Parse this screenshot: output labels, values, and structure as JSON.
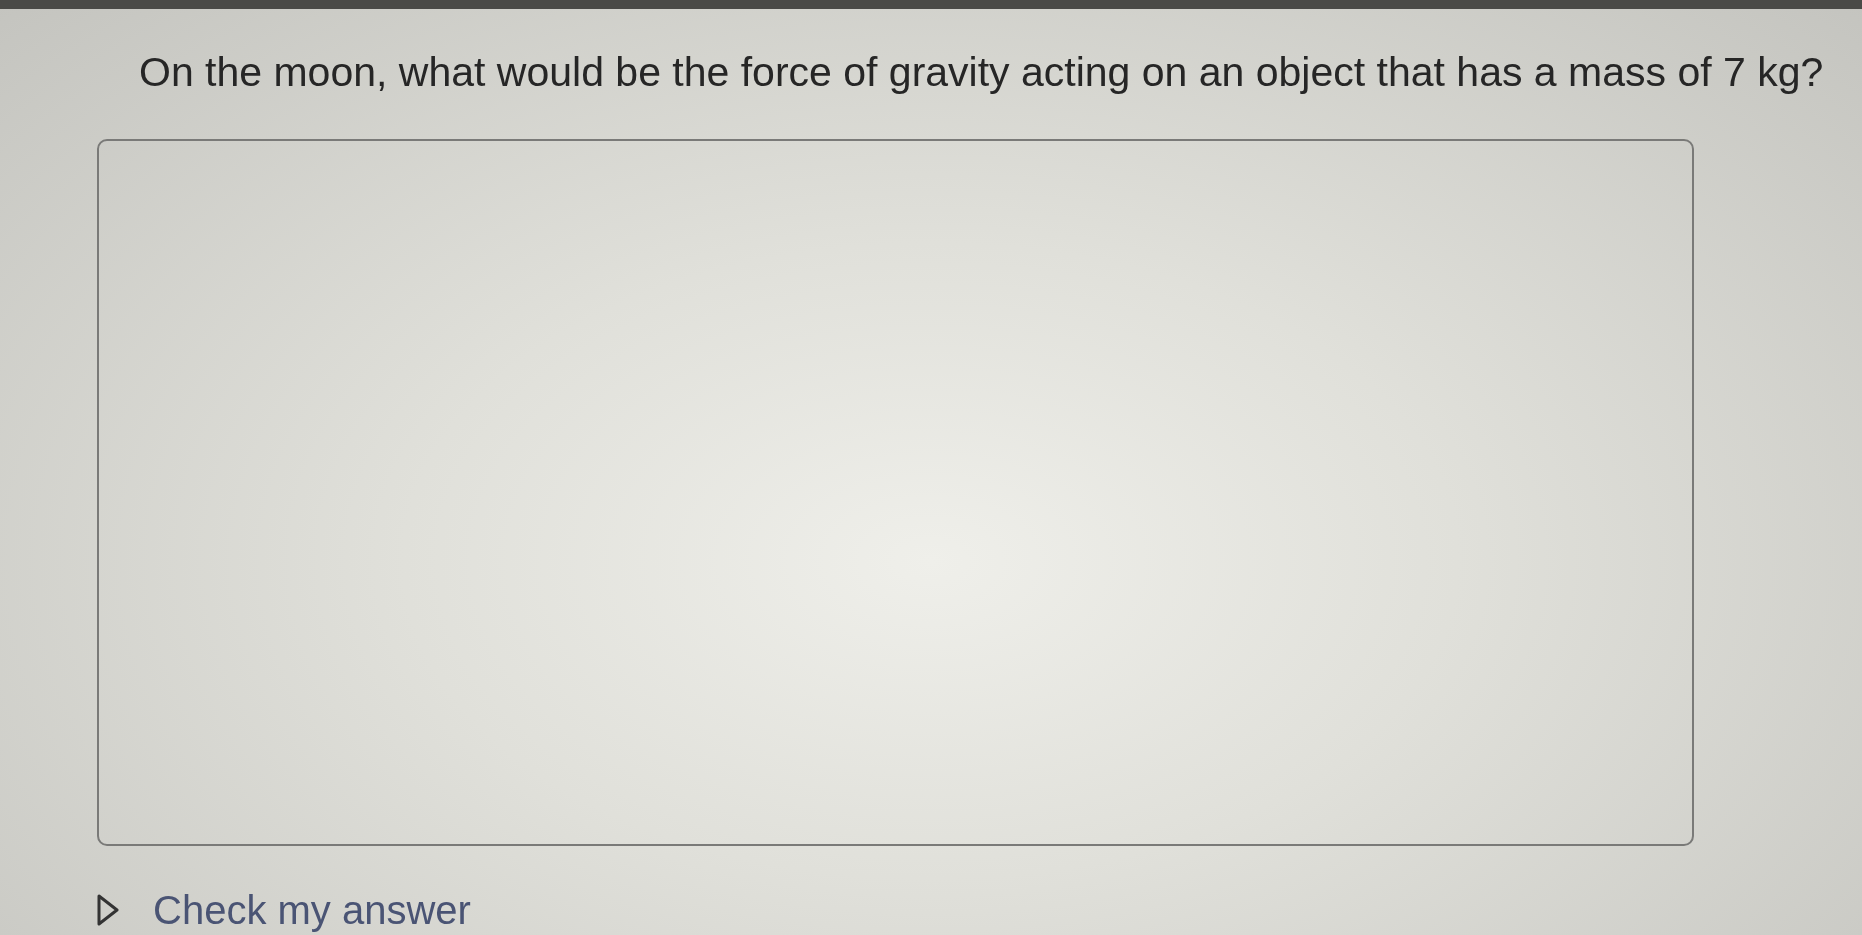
{
  "question": {
    "text": "On the moon, what would be the force of gravity acting on an object that has a mass of 7 kg?"
  },
  "hint_toggle": {
    "label": "Check my answer",
    "expanded": false
  }
}
